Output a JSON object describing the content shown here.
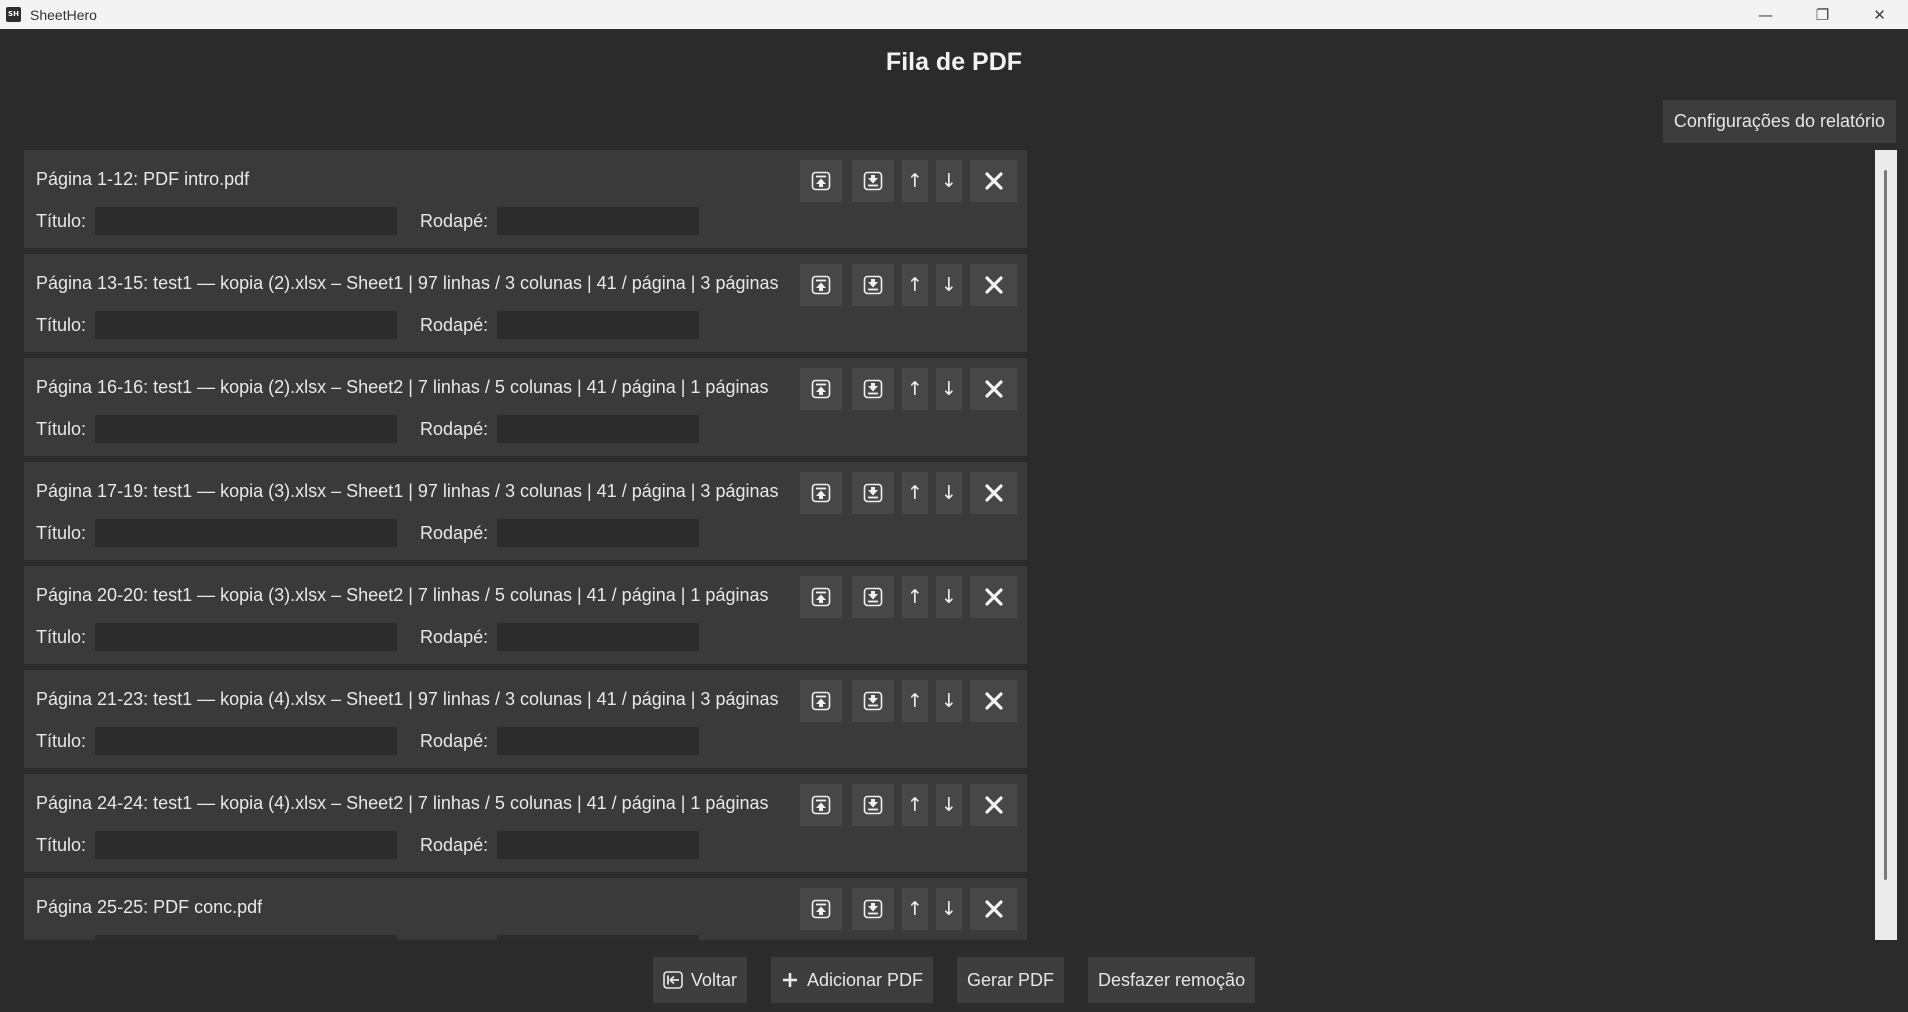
{
  "window": {
    "app_icon_text": "SH",
    "title": "SheetHero",
    "minimize_glyph": "—",
    "restore_glyph": "❐",
    "close_glyph": "✕"
  },
  "page": {
    "title": "Fila de PDF",
    "settings_button": "Configurações do relatório"
  },
  "item_controls": {
    "move_top_icon": "move-to-top-icon",
    "move_bottom_icon": "move-to-bottom-icon",
    "move_up_glyph": "↑",
    "move_down_glyph": "↓",
    "remove_icon": "close-icon"
  },
  "fields": {
    "title_label": "Título:",
    "footer_label": "Rodapé:"
  },
  "queue_items": [
    {
      "label": "Página 1-12: PDF intro.pdf",
      "title_value": "",
      "footer_value": ""
    },
    {
      "label": "Página 13-15: test1 — kopia (2).xlsx – Sheet1 | 97 linhas / 3 colunas | 41 / página | 3 páginas",
      "title_value": "",
      "footer_value": ""
    },
    {
      "label": "Página 16-16: test1 — kopia (2).xlsx – Sheet2 | 7 linhas / 5 colunas | 41 / página | 1 páginas",
      "title_value": "",
      "footer_value": ""
    },
    {
      "label": "Página 17-19: test1 — kopia (3).xlsx – Sheet1 | 97 linhas / 3 colunas | 41 / página | 3 páginas",
      "title_value": "",
      "footer_value": ""
    },
    {
      "label": "Página 20-20: test1 — kopia (3).xlsx – Sheet2 | 7 linhas / 5 colunas | 41 / página | 1 páginas",
      "title_value": "",
      "footer_value": ""
    },
    {
      "label": "Página 21-23: test1 — kopia (4).xlsx – Sheet1 | 97 linhas / 3 colunas | 41 / página | 3 páginas",
      "title_value": "",
      "footer_value": ""
    },
    {
      "label": "Página 24-24: test1 — kopia (4).xlsx – Sheet2 | 7 linhas / 5 colunas | 41 / página | 1 páginas",
      "title_value": "",
      "footer_value": ""
    },
    {
      "label": "Página 25-25: PDF conc.pdf",
      "title_value": "",
      "footer_value": ""
    }
  ],
  "bottom_bar": {
    "back_label": "Voltar",
    "add_pdf_label": "Adicionar PDF",
    "generate_pdf_label": "Gerar PDF",
    "undo_remove_label": "Desfazer remoção"
  }
}
